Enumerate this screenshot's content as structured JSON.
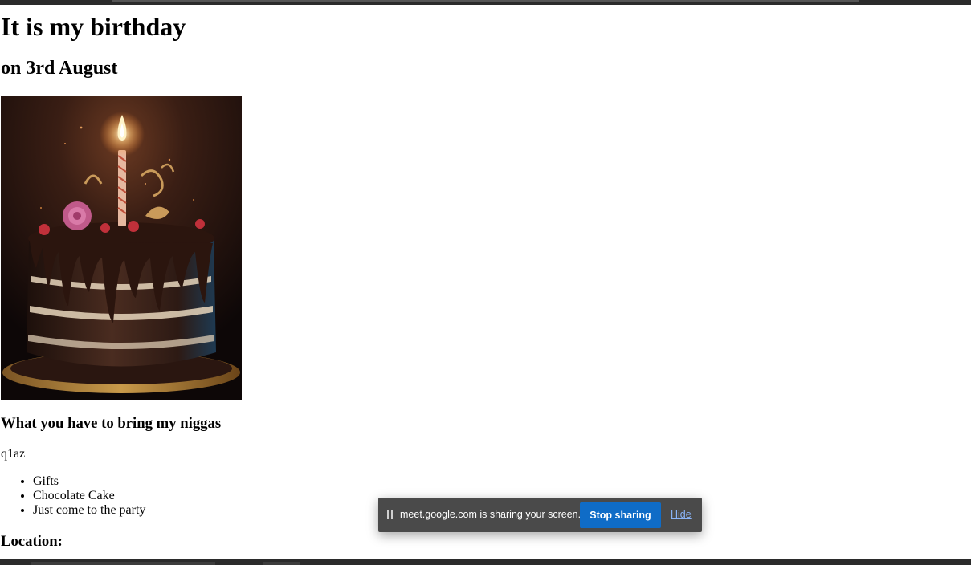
{
  "page": {
    "title": "It is my birthday",
    "subtitle": "on 3rd August",
    "image_alt": "birthday-cake-with-candle",
    "bring_heading": "What you have to bring my niggas",
    "paragraph": "q1az",
    "items": [
      "Gifts",
      "Chocolate Cake",
      "Just come to the party"
    ],
    "location_heading": "Location:"
  },
  "share_bar": {
    "message": "meet.google.com is sharing your screen.",
    "stop_label": "Stop sharing",
    "hide_label": "Hide",
    "button_color": "#0f6cc7",
    "link_color": "#8ab4f8"
  }
}
